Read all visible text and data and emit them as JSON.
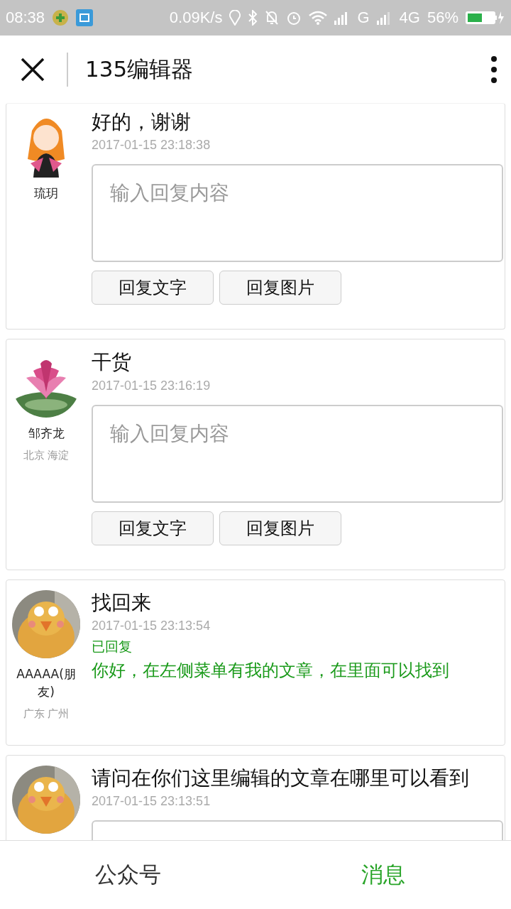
{
  "status_bar": {
    "time": "08:38",
    "speed": "0.09K/s",
    "network_1": "G",
    "network_2": "4G",
    "battery": "56%"
  },
  "header": {
    "title": "135编辑器"
  },
  "messages": [
    {
      "kind": "reply_form",
      "avatar": {
        "kind": "cartoon"
      },
      "name": "琉玥",
      "text": "好的，谢谢",
      "time": "2017-01-15 23:18:38",
      "placeholder": "输入回复内容",
      "buttons": [
        "回复文字",
        "回复图片"
      ]
    },
    {
      "kind": "reply_form",
      "avatar": {
        "kind": "lotus"
      },
      "name": "邹齐龙",
      "location": "北京 海淀",
      "text": "干货",
      "time": "2017-01-15 23:16:19",
      "placeholder": "输入回复内容",
      "buttons": [
        "回复文字",
        "回复图片"
      ]
    },
    {
      "kind": "replied",
      "avatar": {
        "kind": "chick"
      },
      "name": "AAAAA(朋友)",
      "location": "广东 广州",
      "text": "找回来",
      "time": "2017-01-15 23:13:54",
      "replied_label": "已回复",
      "reply": "你好，在左侧菜单有我的文章，在里面可以找到"
    },
    {
      "kind": "reply_form",
      "avatar": {
        "kind": "chick"
      },
      "text": "请问在你们这里编辑的文章在哪里可以看到",
      "time": "2017-01-15 23:13:51"
    }
  ],
  "tabs": [
    {
      "label": "公众号",
      "selected": false
    },
    {
      "label": "消息",
      "selected": true
    }
  ]
}
